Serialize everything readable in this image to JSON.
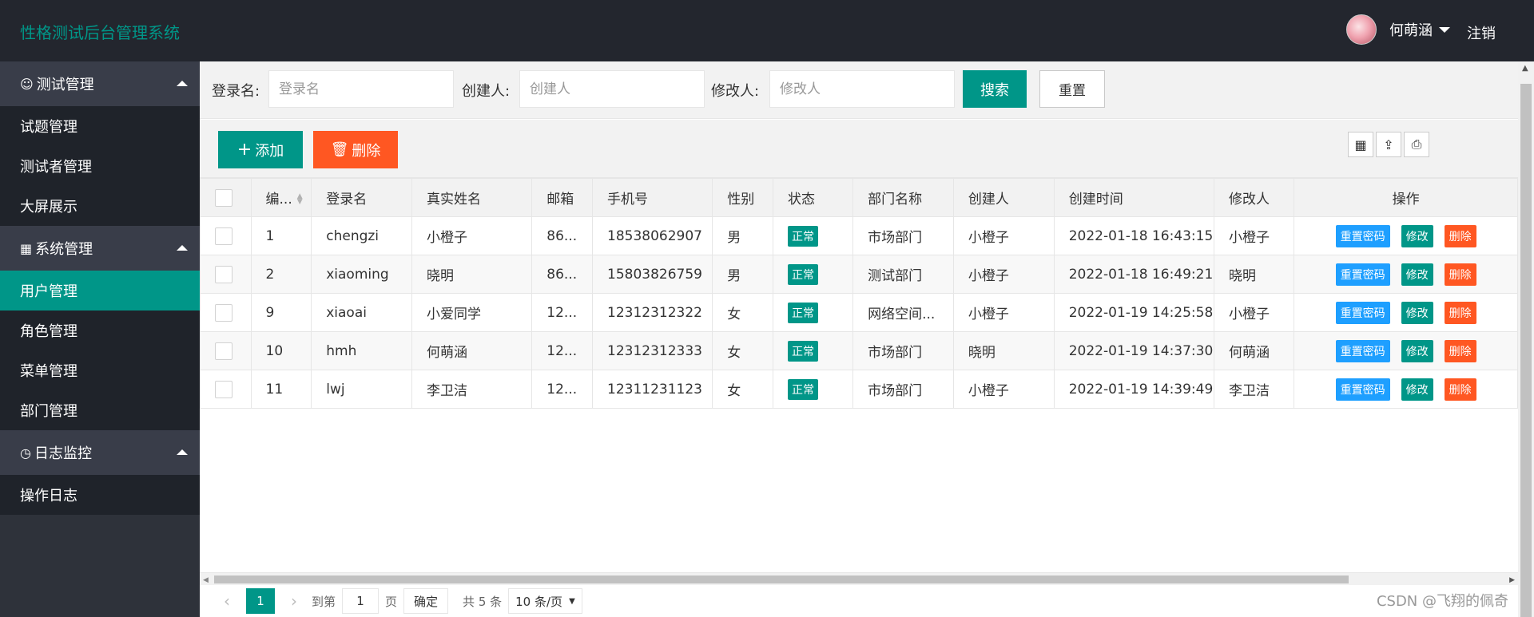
{
  "app": {
    "title": "性格测试后台管理系统"
  },
  "header": {
    "user_name": "何萌涵",
    "logout": "注销"
  },
  "sidebar": {
    "groups": [
      {
        "label": "测试管理",
        "icon": "user-icon",
        "items": [
          "试题管理",
          "测试者管理",
          "大屏展示"
        ]
      },
      {
        "label": "系统管理",
        "icon": "apps-icon",
        "items": [
          "用户管理",
          "角色管理",
          "菜单管理",
          "部门管理"
        ]
      },
      {
        "label": "日志监控",
        "icon": "clock-icon",
        "items": [
          "操作日志"
        ]
      }
    ],
    "active_item": "用户管理"
  },
  "search": {
    "login_label": "登录名:",
    "login_placeholder": "登录名",
    "creator_label": "创建人:",
    "creator_placeholder": "创建人",
    "modifier_label": "修改人:",
    "modifier_placeholder": "修改人",
    "search_button": "搜索",
    "reset_button": "重置"
  },
  "toolbar": {
    "add_label": "添加",
    "delete_label": "删除"
  },
  "table": {
    "columns": [
      "编...",
      "登录名",
      "真实姓名",
      "邮箱",
      "手机号",
      "性别",
      "状态",
      "部门名称",
      "创建人",
      "创建时间",
      "修改人",
      "操作"
    ],
    "rows": [
      {
        "id": "1",
        "login": "chengzi",
        "name": "小橙子",
        "email": "86...",
        "phone": "18538062907",
        "gender": "男",
        "status": "正常",
        "dept": "市场部门",
        "creator": "小橙子",
        "created": "2022-01-18 16:43:15",
        "modifier": "小橙子"
      },
      {
        "id": "2",
        "login": "xiaoming",
        "name": "晓明",
        "email": "86...",
        "phone": "15803826759",
        "gender": "男",
        "status": "正常",
        "dept": "测试部门",
        "creator": "小橙子",
        "created": "2022-01-18 16:49:21",
        "modifier": "晓明"
      },
      {
        "id": "9",
        "login": "xiaoai",
        "name": "小爱同学",
        "email": "12...",
        "phone": "12312312322",
        "gender": "女",
        "status": "正常",
        "dept": "网络空间...",
        "creator": "小橙子",
        "created": "2022-01-19 14:25:58",
        "modifier": "小橙子"
      },
      {
        "id": "10",
        "login": "hmh",
        "name": "何萌涵",
        "email": "12...",
        "phone": "12312312333",
        "gender": "女",
        "status": "正常",
        "dept": "市场部门",
        "creator": "晓明",
        "created": "2022-01-19 14:37:30",
        "modifier": "何萌涵"
      },
      {
        "id": "11",
        "login": "lwj",
        "name": "李卫洁",
        "email": "12...",
        "phone": "12311231123",
        "gender": "女",
        "status": "正常",
        "dept": "市场部门",
        "creator": "小橙子",
        "created": "2022-01-19 14:39:49",
        "modifier": "李卫洁"
      }
    ],
    "row_actions": {
      "reset_pwd": "重置密码",
      "edit": "修改",
      "delete": "删除"
    }
  },
  "pager": {
    "current": "1",
    "goto_label": "到第",
    "goto_value": "1",
    "page_unit": "页",
    "confirm": "确定",
    "total": "共 5 条",
    "page_size": "10 条/页"
  },
  "watermark": "CSDN @飞翔的佩奇",
  "colors": {
    "primary": "#009688",
    "danger": "#ff5722",
    "info": "#1e9fff",
    "header_bg": "#23262e"
  }
}
